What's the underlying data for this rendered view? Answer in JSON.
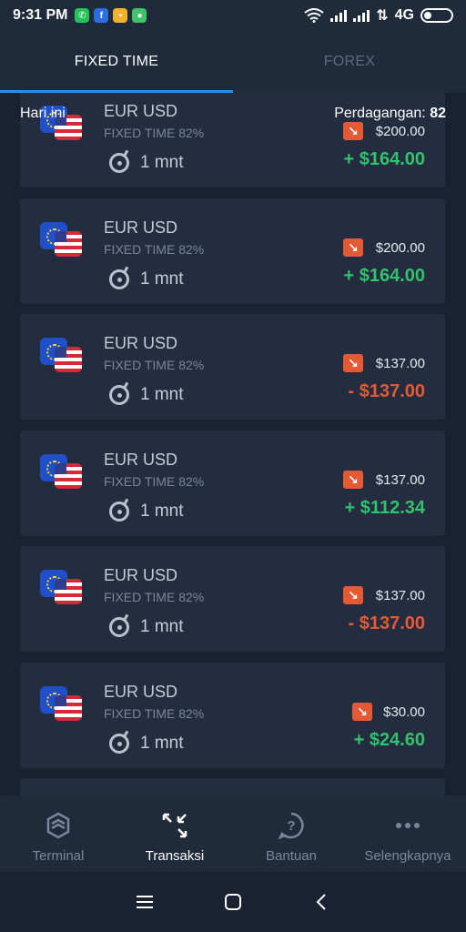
{
  "status_bar": {
    "time": "9:31 PM",
    "network": "4G",
    "icons": [
      "whatsapp-icon",
      "facebook-icon",
      "message-icon",
      "android-icon",
      "wifi-icon",
      "signal-icon",
      "battery-icon"
    ]
  },
  "tabs": [
    {
      "label": "FIXED TIME",
      "active": true
    },
    {
      "label": "FOREX",
      "active": false
    }
  ],
  "header": {
    "left": "Hari ini",
    "right_label": "Perdagangan:",
    "right_value": "82"
  },
  "trades": [
    {
      "pair": "EUR USD",
      "type": "FIXED TIME 82%",
      "duration": "1 mnt",
      "direction": "down",
      "amount": "$200.00",
      "result": "+ $164.00",
      "outcome": "win"
    },
    {
      "pair": "EUR USD",
      "type": "FIXED TIME 82%",
      "duration": "1 mnt",
      "direction": "down",
      "amount": "$200.00",
      "result": "+ $164.00",
      "outcome": "win"
    },
    {
      "pair": "EUR USD",
      "type": "FIXED TIME 82%",
      "duration": "1 mnt",
      "direction": "down",
      "amount": "$137.00",
      "result": "- $137.00",
      "outcome": "loss"
    },
    {
      "pair": "EUR USD",
      "type": "FIXED TIME 82%",
      "duration": "1 mnt",
      "direction": "down",
      "amount": "$137.00",
      "result": "+ $112.34",
      "outcome": "win"
    },
    {
      "pair": "EUR USD",
      "type": "FIXED TIME 82%",
      "duration": "1 mnt",
      "direction": "down",
      "amount": "$137.00",
      "result": "- $137.00",
      "outcome": "loss"
    },
    {
      "pair": "EUR USD",
      "type": "FIXED TIME 82%",
      "duration": "1 mnt",
      "direction": "down",
      "amount": "$30.00",
      "result": "+ $24.60",
      "outcome": "win"
    }
  ],
  "bottom_nav": [
    {
      "label": "Terminal",
      "icon": "terminal-icon",
      "active": false
    },
    {
      "label": "Transaksi",
      "icon": "transactions-icon",
      "active": true
    },
    {
      "label": "Bantuan",
      "icon": "help-icon",
      "active": false
    },
    {
      "label": "Selengkapnya",
      "icon": "more-icon",
      "active": false
    }
  ],
  "colors": {
    "background": "#1a2232",
    "card": "#232d3f",
    "accent": "#2f8fe8",
    "win": "#31c26d",
    "loss": "#e45a35"
  }
}
